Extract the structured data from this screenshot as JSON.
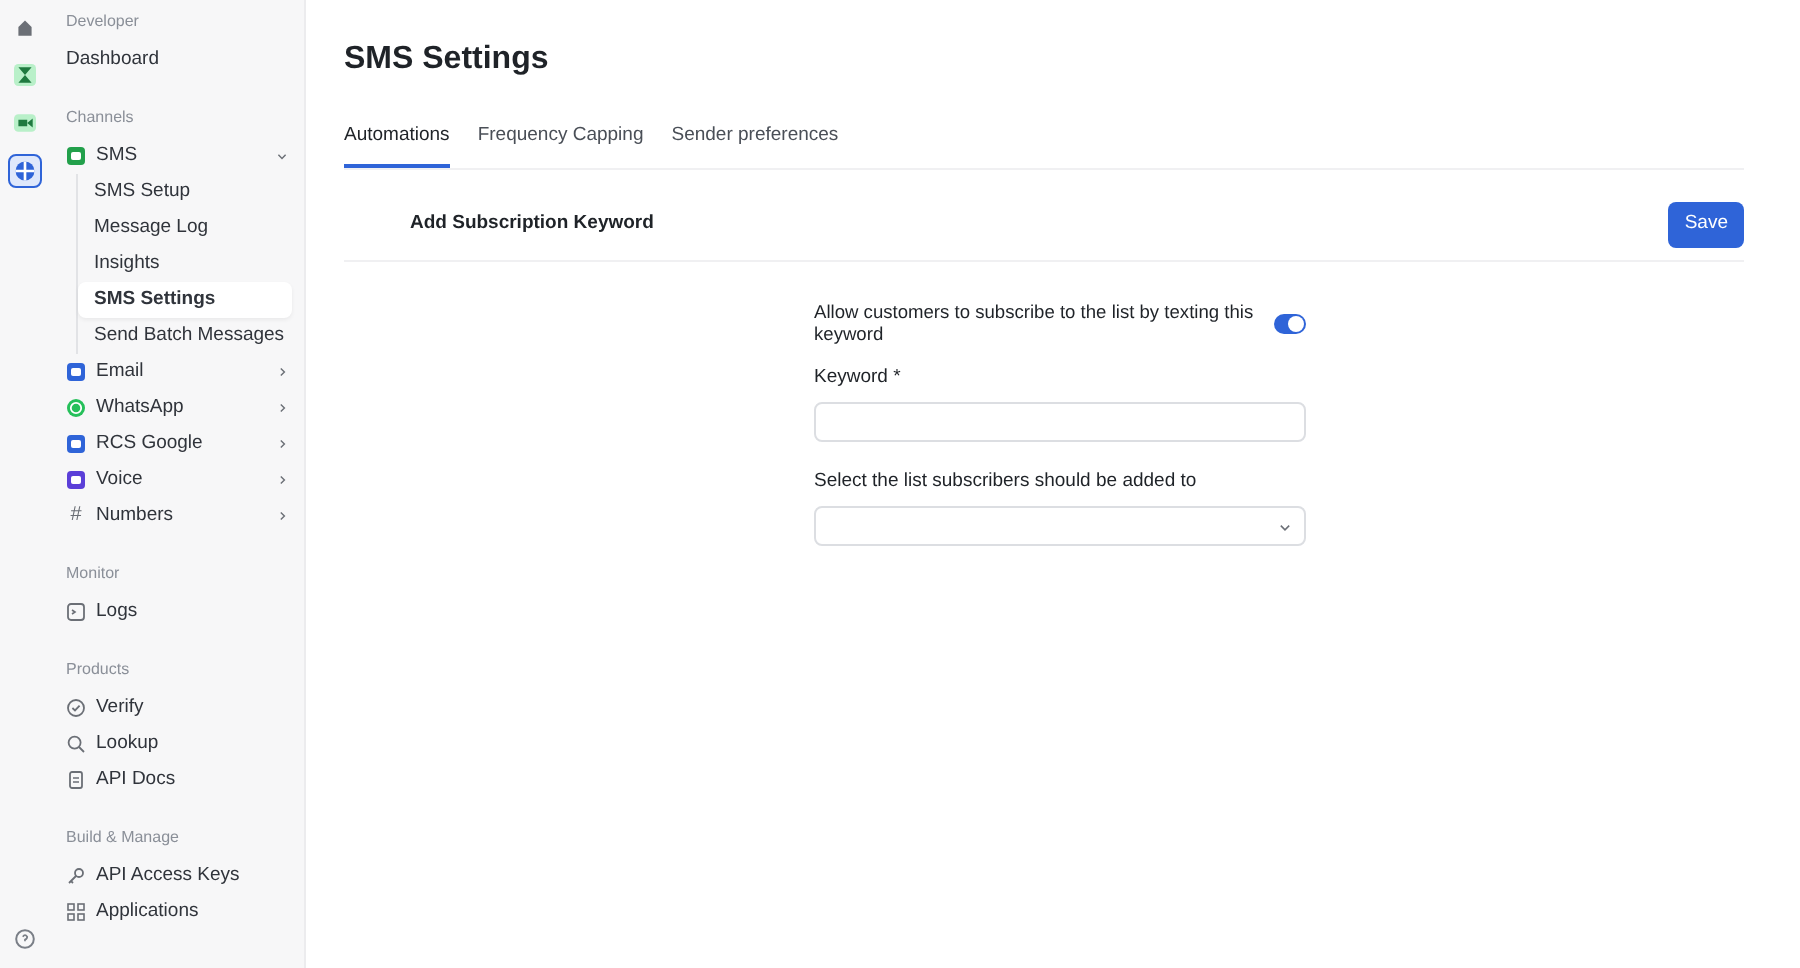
{
  "rail": [
    {
      "kind": "home",
      "selected": false
    },
    {
      "kind": "hourglass",
      "selected": false
    },
    {
      "kind": "video",
      "selected": false
    },
    {
      "kind": "globe",
      "selected": true
    }
  ],
  "rail_bottom": {
    "kind": "help"
  },
  "sidebar": {
    "sections": [
      {
        "heading": "Developer",
        "items": [
          {
            "label": "Dashboard",
            "kind": "none",
            "selected": false
          }
        ]
      },
      {
        "heading": "Channels",
        "items": [
          {
            "label": "SMS",
            "kind": "square",
            "color": "#22a04b",
            "expanded": true,
            "selected": false,
            "children": [
              {
                "label": "SMS Setup",
                "selected": false
              },
              {
                "label": "Message Log",
                "selected": false
              },
              {
                "label": "Insights",
                "selected": false
              },
              {
                "label": "SMS Settings",
                "selected": true
              },
              {
                "label": "Send Batch Messages",
                "selected": false
              }
            ]
          },
          {
            "label": "Email",
            "kind": "square",
            "color": "#2f64d8",
            "expanded": false,
            "selected": false
          },
          {
            "label": "WhatsApp",
            "kind": "whatsapp",
            "color": "#25c05a",
            "expanded": false,
            "selected": false
          },
          {
            "label": "RCS Google",
            "kind": "square",
            "color": "#2f64d8",
            "expanded": false,
            "selected": false
          },
          {
            "label": "Voice",
            "kind": "square",
            "color": "#5b3fd8",
            "expanded": false,
            "selected": false
          },
          {
            "label": "Numbers",
            "kind": "hash",
            "glyph": "#",
            "expanded": false,
            "selected": false
          }
        ]
      },
      {
        "heading": "Monitor",
        "items": [
          {
            "label": "Logs",
            "kind": "terminal",
            "selected": false
          }
        ]
      },
      {
        "heading": "Products",
        "items": [
          {
            "label": "Verify",
            "kind": "check",
            "selected": false
          },
          {
            "label": "Lookup",
            "kind": "search",
            "selected": false
          },
          {
            "label": "API Docs",
            "kind": "doc",
            "selected": false
          }
        ]
      },
      {
        "heading": "Build & Manage",
        "items": [
          {
            "label": "API Access Keys",
            "kind": "key",
            "selected": false
          },
          {
            "label": "Applications",
            "kind": "grid",
            "selected": false
          }
        ]
      }
    ]
  },
  "page": {
    "title": "SMS Settings",
    "tabs": [
      {
        "label": "Automations",
        "selected": true
      },
      {
        "label": "Frequency Capping",
        "selected": false
      },
      {
        "label": "Sender preferences",
        "selected": false
      }
    ],
    "section_title": "Add Subscription Keyword",
    "save_button": "Save",
    "toggle": {
      "label": "Allow customers to subscribe to the list by texting this keyword",
      "on": true
    },
    "keyword": {
      "label": "Keyword *"
    },
    "list_select": {
      "label": "Select the list subscribers should be added to"
    }
  }
}
